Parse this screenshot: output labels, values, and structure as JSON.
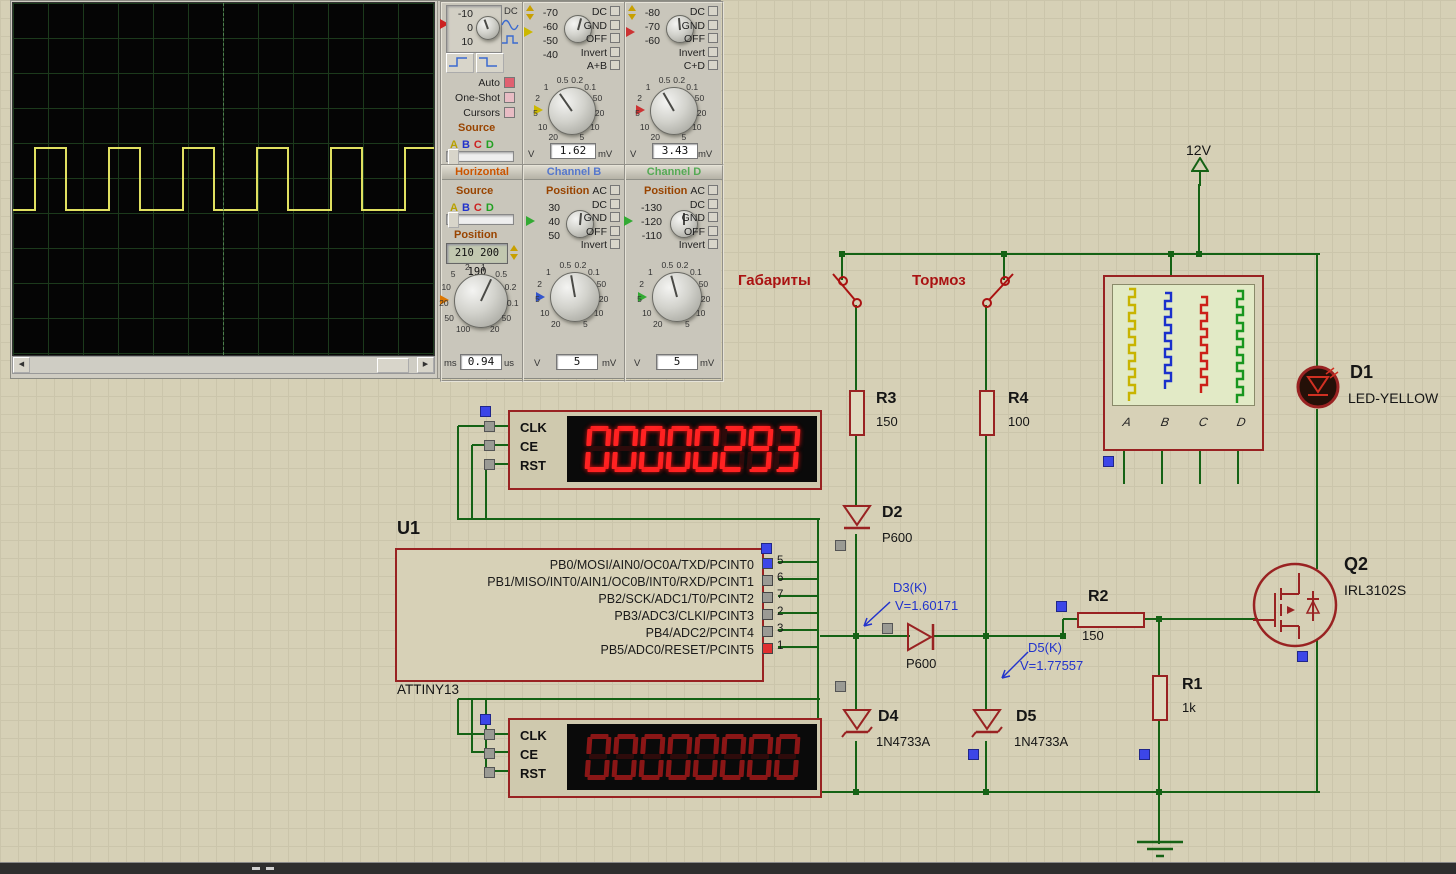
{
  "scope": {
    "v_scale": [
      "20",
      "10",
      "5",
      "2",
      "1",
      "0.5",
      "0.2",
      "0.1",
      "50",
      "20",
      "10",
      "5"
    ],
    "t_scale": [
      "100",
      "50",
      "20",
      "10",
      "5",
      "2",
      "1",
      "0.5",
      "0.2",
      "0.1",
      "50",
      "20"
    ],
    "trace": "square-wave",
    "trigger": {
      "pos_values": [
        "-10",
        "0",
        "10"
      ],
      "coupling_label": "DC",
      "buttons": [
        "Auto",
        "One-Shot",
        "Cursors"
      ],
      "source_label": "Source",
      "channels": [
        {
          "label": "A",
          "color": "#b8a000"
        },
        {
          "label": "B",
          "color": "#2233cc"
        },
        {
          "label": "C",
          "color": "#cc2222"
        },
        {
          "label": "D",
          "color": "#22a022"
        }
      ]
    },
    "channel_a": {
      "pos_values": [
        "-70",
        "-60",
        "-50",
        "-40"
      ],
      "coupling": [
        "DC",
        "GND",
        "OFF",
        "Invert",
        "A+B"
      ],
      "readout": "1.62",
      "unit_left": "V",
      "unit_right": "mV"
    },
    "channel_c": {
      "pos_values": [
        "-80",
        "-70",
        "-60"
      ],
      "coupling": [
        "DC",
        "GND",
        "OFF",
        "Invert",
        "C+D"
      ],
      "readout": "3.43",
      "unit_left": "V",
      "unit_right": "mV"
    },
    "horizontal": {
      "title": "Horizontal",
      "source_label": "Source",
      "channels": [
        {
          "label": "A",
          "color": "#b8a000"
        },
        {
          "label": "B",
          "color": "#2233cc"
        },
        {
          "label": "C",
          "color": "#cc2222"
        },
        {
          "label": "D",
          "color": "#22a022"
        }
      ],
      "position_label": "Position",
      "position_display": "210 200 190",
      "readout": "0.94",
      "unit_left": "ms",
      "unit_right": "us"
    },
    "channel_b": {
      "title": "Channel B",
      "position_label": "Position",
      "pos_values": [
        "30",
        "40",
        "50"
      ],
      "coupling": [
        "AC",
        "DC",
        "GND",
        "OFF",
        "Invert"
      ],
      "readout": "5",
      "unit_left": "V",
      "unit_right": "mV"
    },
    "channel_d": {
      "title": "Channel D",
      "position_label": "Position",
      "pos_values": [
        "-130",
        "-120",
        "-110"
      ],
      "coupling": [
        "AC",
        "DC",
        "GND",
        "OFF",
        "Invert"
      ],
      "readout": "5",
      "unit_left": "V",
      "unit_right": "mV"
    }
  },
  "circuit": {
    "power_label": "12V",
    "switch_labels": [
      "Габариты",
      "Тормоз"
    ],
    "r3": {
      "ref": "R3",
      "value": "150"
    },
    "r4": {
      "ref": "R4",
      "value": "100"
    },
    "r2": {
      "ref": "R2",
      "value": "150"
    },
    "r1": {
      "ref": "R1",
      "value": "1k"
    },
    "d2": {
      "ref": "D2",
      "value": "P600"
    },
    "d6": {
      "value": "P600"
    },
    "d4": {
      "ref": "D4",
      "value": "1N4733A"
    },
    "d5": {
      "ref": "D5",
      "value": "1N4733A"
    },
    "d1": {
      "ref": "D1",
      "value": "LED-YELLOW"
    },
    "q2": {
      "ref": "Q2",
      "value": "IRL3102S"
    },
    "probe1": {
      "label": "D3(K)",
      "voltage": "V=1.60171"
    },
    "probe2": {
      "label": "D5(K)",
      "voltage": "V=1.77557"
    },
    "mcu": {
      "ref": "U1",
      "value": "ATTINY13",
      "pins": [
        {
          "name": "PB0/MOSI/AIN0/OC0A/TXD/PCINT0",
          "num": "5",
          "state": "blue"
        },
        {
          "name": "PB1/MISO/INT0/AIN1/OC0B/INT0/RXD/PCINT1",
          "num": "6",
          "state": "gray"
        },
        {
          "name": "PB2/SCK/ADC1/T0/PCINT2",
          "num": "7",
          "state": "gray"
        },
        {
          "name": "PB3/ADC3/CLKI/PCINT3",
          "num": "2",
          "state": "gray"
        },
        {
          "name": "PB4/ADC2/PCINT4",
          "num": "3",
          "state": "gray"
        },
        {
          "name": "PB5/ADC0/RESET/PCINT5",
          "num": "1",
          "state": "red"
        }
      ]
    },
    "displays": [
      {
        "pins": [
          "CLK",
          "CE",
          "RST"
        ],
        "digits": "00000293",
        "lit": true
      },
      {
        "pins": [
          "CLK",
          "CE",
          "RST"
        ],
        "digits": "00000000",
        "lit": false
      }
    ],
    "analyzer": {
      "channels": [
        {
          "label": "A",
          "color": "#c8b400"
        },
        {
          "label": "B",
          "color": "#1a30cc"
        },
        {
          "label": "C",
          "color": "#cc2018"
        },
        {
          "label": "D",
          "color": "#18961e"
        }
      ]
    }
  }
}
